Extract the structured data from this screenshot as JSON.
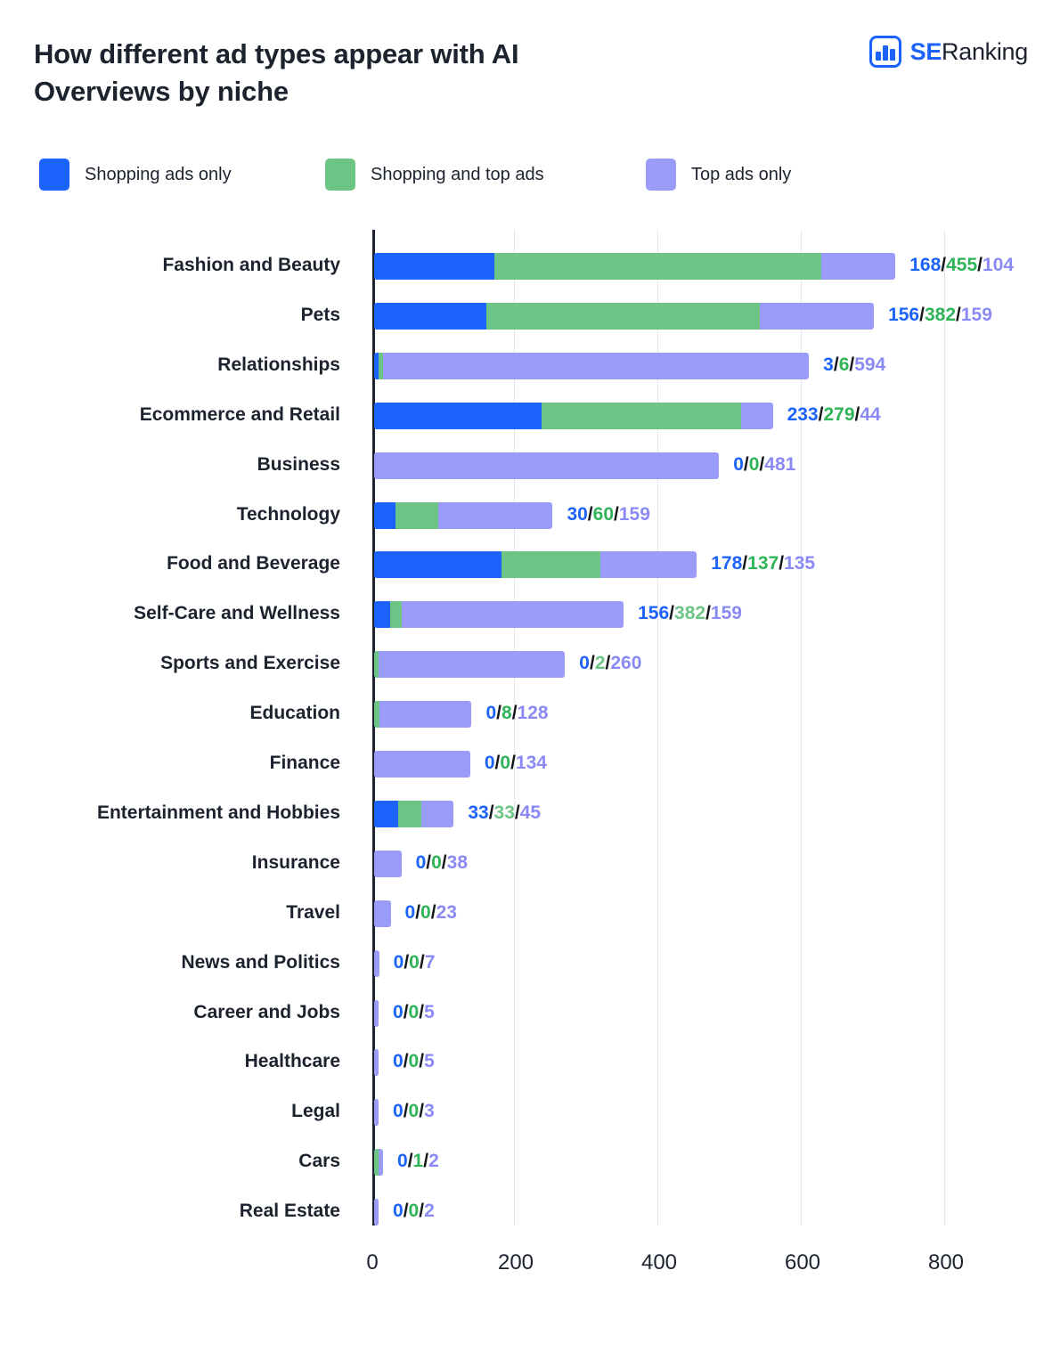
{
  "header": {
    "title": "How different ad types appear with AI Overviews by niche",
    "logo": {
      "brand_primary": "SE",
      "brand_secondary": "Ranking",
      "icon": "bar-chart-logo-icon"
    }
  },
  "legend": {
    "items": [
      {
        "label": "Shopping ads only",
        "color": "#1b63fa"
      },
      {
        "label": "Shopping and top ads",
        "color": "#6cc585"
      },
      {
        "label": "Top ads only",
        "color": "#9b9bfa"
      }
    ]
  },
  "chart_data": {
    "type": "bar",
    "orientation": "horizontal",
    "stacked": true,
    "title": "How different ad types appear with AI Overviews by niche",
    "xlabel": "",
    "ylabel": "",
    "xlim": [
      0,
      880
    ],
    "xticks": [
      0,
      200,
      400,
      600,
      800
    ],
    "grid": "vertical",
    "legend_position": "top",
    "series": [
      {
        "name": "Shopping ads only",
        "color": "#1b63fa",
        "values": [
          168,
          156,
          3,
          233,
          0,
          30,
          178,
          22,
          0,
          0,
          0,
          33,
          0,
          0,
          0,
          0,
          0,
          0,
          0,
          0
        ]
      },
      {
        "name": "Shopping and top ads",
        "color": "#6cc585",
        "values": [
          455,
          382,
          6,
          279,
          0,
          60,
          137,
          16,
          2,
          8,
          0,
          33,
          0,
          0,
          0,
          0,
          0,
          0,
          1,
          0
        ]
      },
      {
        "name": "Top ads only",
        "color": "#9b9bfa",
        "values": [
          104,
          159,
          594,
          44,
          481,
          159,
          135,
          310,
          260,
          128,
          134,
          45,
          38,
          23,
          7,
          5,
          5,
          3,
          2,
          2
        ]
      }
    ],
    "categories": [
      "Fashion and Beauty",
      "Pets",
      "Relationships",
      "Ecommerce and Retail",
      "Business",
      "Technology",
      "Food and Beverage",
      "Self-Care and Wellness",
      "Sports and Exercise",
      "Education",
      "Finance",
      "Entertainment and Hobbies",
      "Insurance",
      "Travel",
      "News and Politics",
      "Career and Jobs",
      "Healthcare",
      "Legal",
      "Cars",
      "Real Estate"
    ],
    "rows": [
      {
        "category": "Fashion and Beauty",
        "bar": [
          168,
          455,
          104
        ],
        "labels": [
          "168",
          "455",
          "104"
        ],
        "label_green_soft": false
      },
      {
        "category": "Pets",
        "bar": [
          156,
          382,
          159
        ],
        "labels": [
          "156",
          "382",
          "159"
        ],
        "label_green_soft": false
      },
      {
        "category": "Relationships",
        "bar": [
          3,
          6,
          594
        ],
        "labels": [
          "3",
          "6",
          "594"
        ],
        "label_green_soft": false
      },
      {
        "category": "Ecommerce and Retail",
        "bar": [
          233,
          279,
          44
        ],
        "labels": [
          "233",
          "279",
          "44"
        ],
        "label_green_soft": false
      },
      {
        "category": "Business",
        "bar": [
          0,
          0,
          481
        ],
        "labels": [
          "0",
          "0",
          "481"
        ],
        "label_green_soft": false
      },
      {
        "category": "Technology",
        "bar": [
          30,
          60,
          159
        ],
        "labels": [
          "30",
          "60",
          "159"
        ],
        "label_green_soft": false
      },
      {
        "category": "Food and Beverage",
        "bar": [
          178,
          137,
          135
        ],
        "labels": [
          "178",
          "137",
          "135"
        ],
        "label_green_soft": false
      },
      {
        "category": "Self-Care and Wellness",
        "bar": [
          22,
          16,
          310
        ],
        "labels": [
          "156",
          "382",
          "159"
        ],
        "label_green_soft": true
      },
      {
        "category": "Sports and Exercise",
        "bar": [
          0,
          2,
          260
        ],
        "labels": [
          "0",
          "2",
          "260"
        ],
        "label_green_soft": true
      },
      {
        "category": "Education",
        "bar": [
          0,
          8,
          128
        ],
        "labels": [
          "0",
          "8",
          "128"
        ],
        "label_green_soft": false
      },
      {
        "category": "Finance",
        "bar": [
          0,
          0,
          134
        ],
        "labels": [
          "0",
          "0",
          "134"
        ],
        "label_green_soft": false
      },
      {
        "category": "Entertainment and Hobbies",
        "bar": [
          33,
          33,
          45
        ],
        "labels": [
          "33",
          "33",
          "45"
        ],
        "label_green_soft": true
      },
      {
        "category": "Insurance",
        "bar": [
          0,
          0,
          38
        ],
        "labels": [
          "0",
          "0",
          "38"
        ],
        "label_green_soft": false
      },
      {
        "category": "Travel",
        "bar": [
          0,
          0,
          23
        ],
        "labels": [
          "0",
          "0",
          "23"
        ],
        "label_green_soft": false
      },
      {
        "category": "News and Politics",
        "bar": [
          0,
          0,
          7
        ],
        "labels": [
          "0",
          "0",
          "7"
        ],
        "label_green_soft": false
      },
      {
        "category": "Career and Jobs",
        "bar": [
          0,
          0,
          5
        ],
        "labels": [
          "0",
          "0",
          "5"
        ],
        "label_green_soft": false
      },
      {
        "category": "Healthcare",
        "bar": [
          0,
          0,
          5
        ],
        "labels": [
          "0",
          "0",
          "5"
        ],
        "label_green_soft": false
      },
      {
        "category": "Legal",
        "bar": [
          0,
          0,
          3
        ],
        "labels": [
          "0",
          "0",
          "3"
        ],
        "label_green_soft": false
      },
      {
        "category": "Cars",
        "bar": [
          0,
          1,
          2
        ],
        "labels": [
          "0",
          "1",
          "2"
        ],
        "label_green_soft": false
      },
      {
        "category": "Real Estate",
        "bar": [
          0,
          0,
          2
        ],
        "labels": [
          "0",
          "0",
          "2"
        ],
        "label_green_soft": false
      }
    ]
  },
  "separator": "/"
}
